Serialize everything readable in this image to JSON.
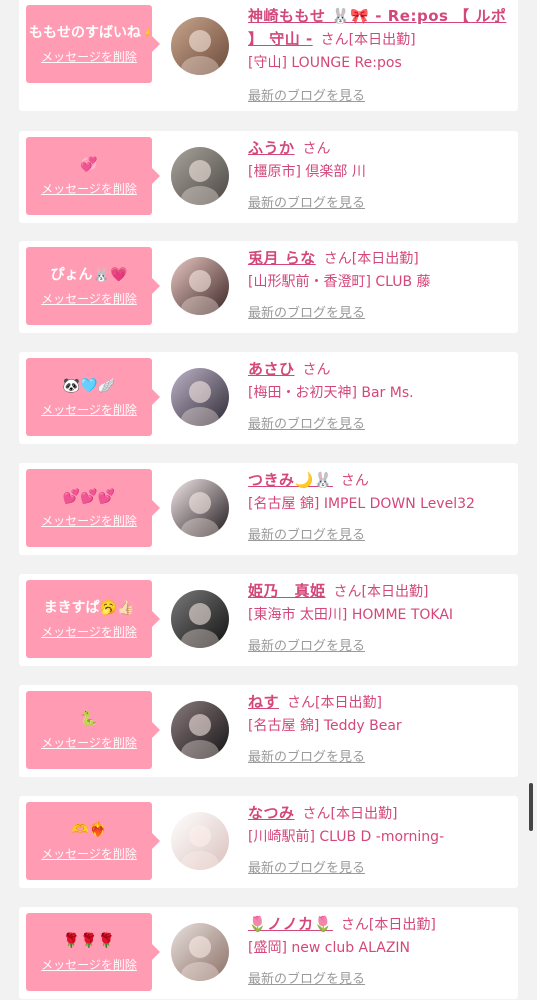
{
  "delete_label": "メッセージを削除",
  "blog_label": "最新のブログを見る",
  "san_label": "さん",
  "colors": {
    "accent": "#d4477a",
    "bubble": "#ff9cb3",
    "background": "#f2f2f2",
    "muted": "#9a9a9a"
  },
  "entries": [
    {
      "message": "ももせのすばいね 🫶🎀",
      "name": "神崎ももせ 🐰🎀 - Re:pos 【 ルポ 】 守山 -",
      "status": "[本日出勤]",
      "shop": "[守山] LOUNGE Re:pos",
      "avatar_colors": [
        "#c9a58c",
        "#6b4a3a"
      ]
    },
    {
      "message": "💞",
      "name": "ふうか",
      "status": "",
      "shop": "[橿原市] 倶楽部 川",
      "avatar_colors": [
        "#a9a59c",
        "#4a4744"
      ]
    },
    {
      "message": "ぴょん🐰💗",
      "name": "兎月 らな",
      "status": "[本日出勤]",
      "shop": "[山形駅前・香澄町] CLUB 藤",
      "avatar_colors": [
        "#e8c7c2",
        "#3a2524"
      ]
    },
    {
      "message": "🐼🩵🪽",
      "name": "あさひ",
      "status": "",
      "shop": "[梅田・お初天神] Bar Ms.",
      "avatar_colors": [
        "#bfb4c9",
        "#2e2a35"
      ]
    },
    {
      "message": "💕💕💕",
      "name": "つきみ🌙🐰",
      "status": "",
      "shop": "[名古屋 錦] IMPEL DOWN Level32",
      "avatar_colors": [
        "#f4e8ea",
        "#1f1a1c"
      ]
    },
    {
      "message": "まきすぱ🥱👍🏻",
      "name": "姫乃　真姫",
      "status": "[本日出勤]",
      "shop": "[東海市 太田川] HOMME TOKAI",
      "avatar_colors": [
        "#7a7a7a",
        "#111111"
      ]
    },
    {
      "message": "🐍",
      "name": "ねす",
      "status": "[本日出勤]",
      "shop": "[名古屋 錦] Teddy Bear",
      "avatar_colors": [
        "#8a7b7d",
        "#151315"
      ]
    },
    {
      "message": "🫶❤️‍🔥",
      "name": "なつみ",
      "status": "[本日出勤]",
      "shop": "[川崎駅前] CLUB D -morning-",
      "avatar_colors": [
        "#ffffff",
        "#d9c1bd"
      ]
    },
    {
      "message": "🌹🌹🌹",
      "name": "🌷ノノカ🌷",
      "status": "[本日出勤]",
      "shop": "[盛岡] new club ALAZIN",
      "avatar_colors": [
        "#e8e1de",
        "#8b6f66"
      ]
    }
  ]
}
